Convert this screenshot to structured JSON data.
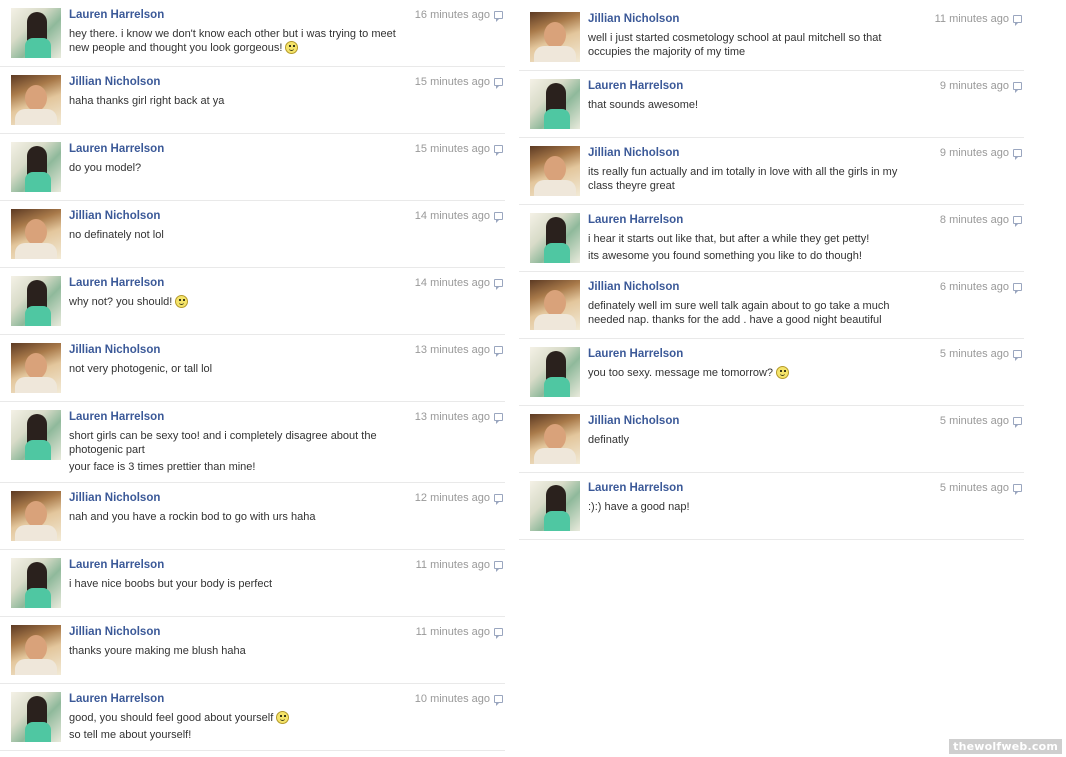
{
  "watermark": "thewolfweb.com",
  "colors": {
    "sender_link": "#3b5998",
    "timestamp": "#999999",
    "divider": "#e9e9e9"
  },
  "left_messages": [
    {
      "sender": "Lauren Harrelson",
      "time": "16 minutes ago",
      "lines": [
        "hey there. i know we don't know each other but i was trying to meet new people and thought you look gorgeous!"
      ],
      "smiley": true,
      "avatar": "lauren"
    },
    {
      "sender": "Jillian Nicholson",
      "time": "15 minutes ago",
      "lines": [
        "haha thanks girl right back at ya"
      ],
      "smiley": false,
      "avatar": "jillian"
    },
    {
      "sender": "Lauren Harrelson",
      "time": "15 minutes ago",
      "lines": [
        "do you model?"
      ],
      "smiley": false,
      "avatar": "lauren"
    },
    {
      "sender": "Jillian Nicholson",
      "time": "14 minutes ago",
      "lines": [
        "no definately not lol"
      ],
      "smiley": false,
      "avatar": "jillian"
    },
    {
      "sender": "Lauren Harrelson",
      "time": "14 minutes ago",
      "lines": [
        "why not? you should!"
      ],
      "smiley": true,
      "avatar": "lauren"
    },
    {
      "sender": "Jillian Nicholson",
      "time": "13 minutes ago",
      "lines": [
        "not very photogenic, or tall lol"
      ],
      "smiley": false,
      "avatar": "jillian"
    },
    {
      "sender": "Lauren Harrelson",
      "time": "13 minutes ago",
      "lines": [
        "short girls can be sexy too! and i completely disagree about the photogenic part",
        "your face is 3 times prettier than mine!"
      ],
      "smiley": false,
      "avatar": "lauren"
    },
    {
      "sender": "Jillian Nicholson",
      "time": "12 minutes ago",
      "lines": [
        "nah and you have a rockin bod to go with urs haha"
      ],
      "smiley": false,
      "avatar": "jillian"
    },
    {
      "sender": "Lauren Harrelson",
      "time": "11 minutes ago",
      "lines": [
        "i have nice boobs but your body is perfect"
      ],
      "smiley": false,
      "avatar": "lauren"
    },
    {
      "sender": "Jillian Nicholson",
      "time": "11 minutes ago",
      "lines": [
        "thanks youre making me blush haha"
      ],
      "smiley": false,
      "avatar": "jillian"
    },
    {
      "sender": "Lauren Harrelson",
      "time": "10 minutes ago",
      "lines": [
        "good, you should feel good about yourself",
        "so tell me about yourself!"
      ],
      "smiley": true,
      "avatar": "lauren"
    }
  ],
  "right_messages": [
    {
      "sender": "Jillian Nicholson",
      "time": "11 minutes ago",
      "lines": [
        "well i just started cosmetology school at paul mitchell so that occupies the majority of my time"
      ],
      "smiley": false,
      "avatar": "jillian"
    },
    {
      "sender": "Lauren Harrelson",
      "time": "9 minutes ago",
      "lines": [
        "that sounds awesome!"
      ],
      "smiley": false,
      "avatar": "lauren"
    },
    {
      "sender": "Jillian Nicholson",
      "time": "9 minutes ago",
      "lines": [
        "its really fun actually and im totally in love with all the girls in my class theyre great"
      ],
      "smiley": false,
      "avatar": "jillian"
    },
    {
      "sender": "Lauren Harrelson",
      "time": "8 minutes ago",
      "lines": [
        "i hear it starts out like that, but after a while they get petty!",
        "its awesome you found something you like to do though!"
      ],
      "smiley": false,
      "avatar": "lauren"
    },
    {
      "sender": "Jillian Nicholson",
      "time": "6 minutes ago",
      "lines": [
        "definately well im sure well talk again about to go take a much needed nap. thanks for the add . have a good night beautiful"
      ],
      "smiley": false,
      "avatar": "jillian"
    },
    {
      "sender": "Lauren Harrelson",
      "time": "5 minutes ago",
      "lines": [
        "you too sexy. message me tomorrow?"
      ],
      "smiley": true,
      "avatar": "lauren"
    },
    {
      "sender": "Jillian Nicholson",
      "time": "5 minutes ago",
      "lines": [
        "definatly"
      ],
      "smiley": false,
      "avatar": "jillian"
    },
    {
      "sender": "Lauren Harrelson",
      "time": "5 minutes ago",
      "lines": [
        ":):) have a good nap!"
      ],
      "smiley": false,
      "avatar": "lauren"
    }
  ]
}
